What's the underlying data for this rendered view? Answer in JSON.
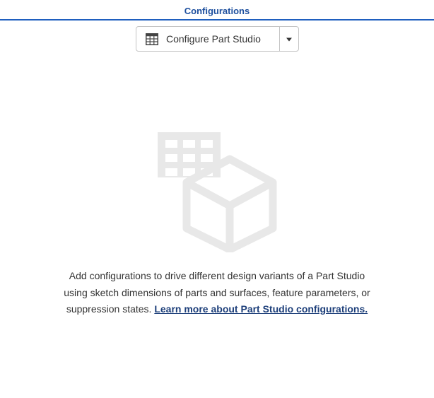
{
  "header": {
    "title": "Configurations"
  },
  "toolbar": {
    "configure_label": "Configure Part Studio",
    "configure_icon": "table-icon",
    "dropdown_icon": "caret-down-icon"
  },
  "empty_state": {
    "illustration_icon": "configuration-table-cube-icon",
    "message": "Add configurations to drive different design variants of a Part Studio using sketch dimensions of parts and surfaces, feature parameters, or suppression states. ",
    "link_label": "Learn more about Part Studio configurations."
  },
  "colors": {
    "accent": "#1f5fbf",
    "title_text": "#1d4f9e",
    "link": "#1d3f7a",
    "illustration": "#e8e8e8"
  }
}
